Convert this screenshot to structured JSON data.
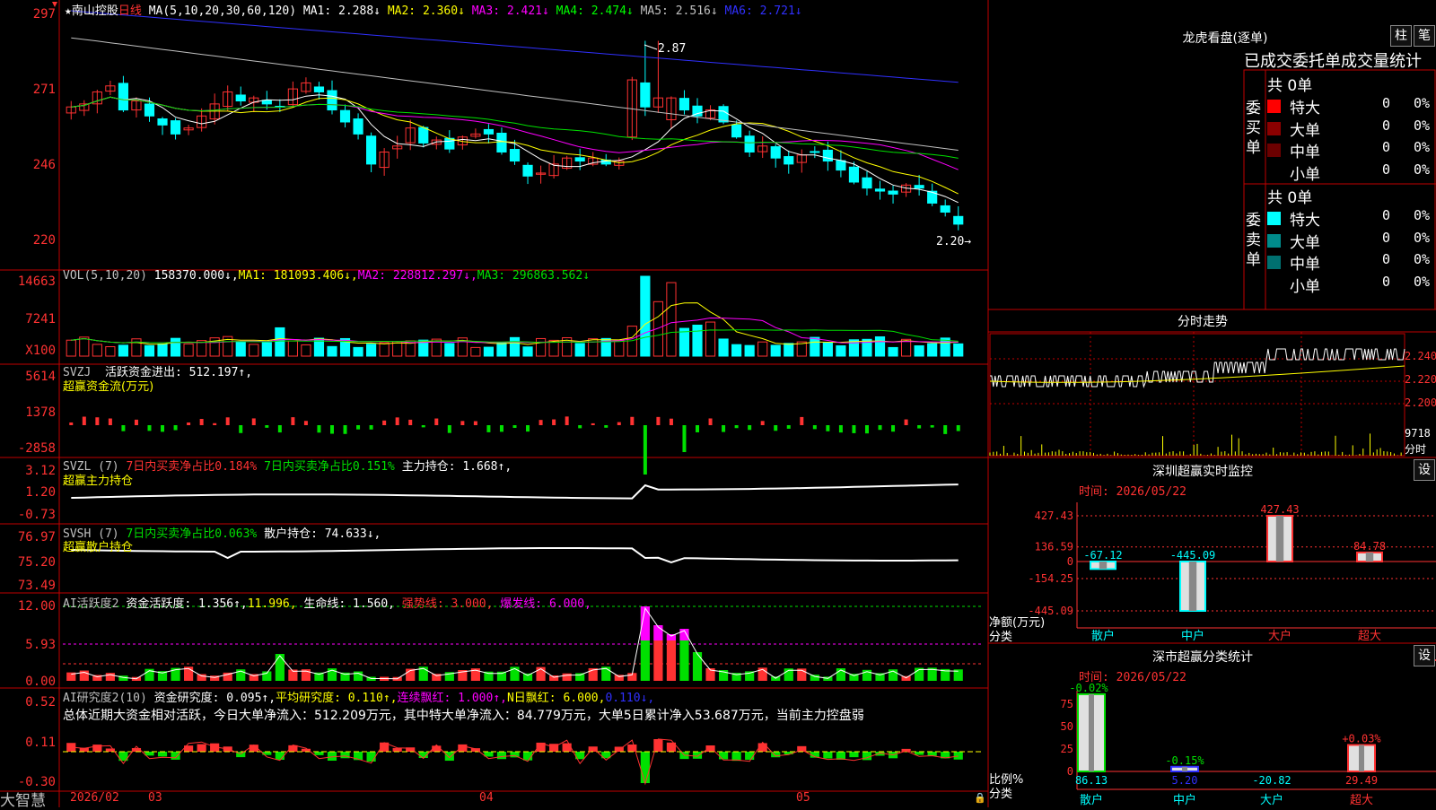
{
  "main": {
    "stock_name": "南山控股",
    "period": "日线",
    "ma_label": "MA(5,10,20,30,60,120)",
    "ma_values": [
      {
        "label": "MA1: 2.288↓",
        "color": "#ffffff"
      },
      {
        "label": "MA2: 2.360↓",
        "color": "#ffff00"
      },
      {
        "label": "MA3: 2.421↓",
        "color": "#ff00ff"
      },
      {
        "label": "MA4: 2.474↓",
        "color": "#00ff00"
      },
      {
        "label": "MA5: 2.516↓",
        "color": "#c0c0c0"
      },
      {
        "label": "MA6: 2.721↓",
        "color": "#3030ff"
      }
    ],
    "y_ticks": [
      "297",
      "271",
      "246",
      "220"
    ],
    "high_label": "2.87",
    "low_label": "2.20→"
  },
  "vol": {
    "title": "VOL(5,10,20)",
    "value": "158370.000↓,",
    "ma1": "MA1: 181093.406↓,",
    "ma2": "MA2: 228812.297↓,",
    "ma3": "MA3: 296863.562↓",
    "y_ticks": [
      "14663",
      "7241",
      "X100"
    ]
  },
  "svzj": {
    "title": "SVZJ",
    "line1": "活跃资金进出: 512.197↑,",
    "line2": "超赢资金流(万元)",
    "y_ticks": [
      "5614",
      "1378",
      "-2858"
    ]
  },
  "svzl": {
    "title": "SVZL (7)",
    "a": "7日内买卖净占比0.184%",
    "b": "7日内买卖净占比0.151%",
    "c": "主力持仓: 1.668↑,",
    "line2": "超赢主力持仓",
    "y_ticks": [
      "3.12",
      "1.20",
      "-0.73"
    ]
  },
  "svsh": {
    "title": "SVSH (7)",
    "a": "7日内买卖净占比0.063%",
    "b": "散户持仓: 74.633↓,",
    "line2": "超赢散户持仓",
    "y_ticks": [
      "76.97",
      "75.20",
      "73.49"
    ]
  },
  "ai1": {
    "title": "AI活跃度2",
    "a": "资金活跃度: 1.356↑,",
    "b": "11.996,",
    "c": "生命线: 1.560,",
    "d": "强势线: 3.000,",
    "e": "爆发线: 6.000,",
    "y_ticks": [
      "12.00",
      "5.93",
      "0.00"
    ]
  },
  "ai2": {
    "title": "AI研究度2(10)",
    "a": "资金研究度: 0.095↑,",
    "b": "平均研究度: 0.110↑,",
    "c": "连续飘红: 1.000↑,",
    "d": "N日飘红: 6.000,",
    "e": "0.110↓,",
    "summary": "总体近期大资金相对活跃，今日大单净流入：512.209万元，其中特大单净流入：84.779万元，大单5日累计净入53.687万元，当前主力控盘弱",
    "y_ticks": [
      "0.52",
      "0.11",
      "-0.30"
    ]
  },
  "xaxis": {
    "brand": "大智慧",
    "labels": [
      "2026/02",
      "03",
      "04",
      "05"
    ]
  },
  "dragon": {
    "title": "龙虎看盘(逐单)",
    "btn1": "柱",
    "btn2": "笔",
    "header": "已成交委托单成交量统计",
    "buy_label": "委买单",
    "sell_label": "委卖单",
    "buy_total": "共 0单",
    "sell_total": "共 0单",
    "buy_rows": [
      {
        "name": "特大",
        "count": "0",
        "pct": "0%",
        "color": "#ff0000"
      },
      {
        "name": "大单",
        "count": "0",
        "pct": "0%",
        "color": "#8b0000"
      },
      {
        "name": "中单",
        "count": "0",
        "pct": "0%",
        "color": "#6b0000"
      },
      {
        "name": "小单",
        "count": "0",
        "pct": "0%",
        "color": ""
      }
    ],
    "sell_rows": [
      {
        "name": "特大",
        "count": "0",
        "pct": "0%",
        "color": "#00ffff"
      },
      {
        "name": "大单",
        "count": "0",
        "pct": "0%",
        "color": "#008b8b"
      },
      {
        "name": "中单",
        "count": "0",
        "pct": "0%",
        "color": "#007070"
      },
      {
        "name": "小单",
        "count": "0",
        "pct": "0%",
        "color": ""
      }
    ]
  },
  "intraday": {
    "title": "分时走势",
    "y_ticks": [
      "2.240",
      "2.220",
      "2.200"
    ],
    "vol_label": "9718",
    "vol_unit": "分时"
  },
  "monitor": {
    "title": "深圳超赢实时监控",
    "btn": "设",
    "time": "时间: 2026/05/22",
    "y_ticks": [
      "427.43",
      "136.59",
      "0",
      "-154.25",
      "-445.09"
    ],
    "ylabel1": "净额(万元)",
    "ylabel2": "分类",
    "bars": [
      {
        "cat": "散户",
        "value": -67.12,
        "label": "-67.12"
      },
      {
        "cat": "中户",
        "value": -445.09,
        "label": "-445.09"
      },
      {
        "cat": "大户",
        "value": 427.43,
        "label": "427.43"
      },
      {
        "cat": "超大",
        "value": 84.78,
        "label": "84.78"
      }
    ]
  },
  "classify": {
    "title": "深市超赢分类统计",
    "btn": "设",
    "time": "时间: 2026/05/22",
    "y_ticks": [
      "75",
      "50",
      "25",
      "0"
    ],
    "ylabel1": "比例%",
    "ylabel2": "分类",
    "bars": [
      {
        "cat": "散户",
        "value": 86.13,
        "top": "-0.02%",
        "bottom": "86.13"
      },
      {
        "cat": "中户",
        "value": 5.2,
        "top": "-0.15%",
        "bottom": "5.20"
      },
      {
        "cat": "大户",
        "value": -20.82,
        "top": "",
        "bottom": "-20.82"
      },
      {
        "cat": "超大",
        "value": 29.49,
        "top": "+0.03%",
        "bottom": "29.49"
      }
    ]
  }
}
